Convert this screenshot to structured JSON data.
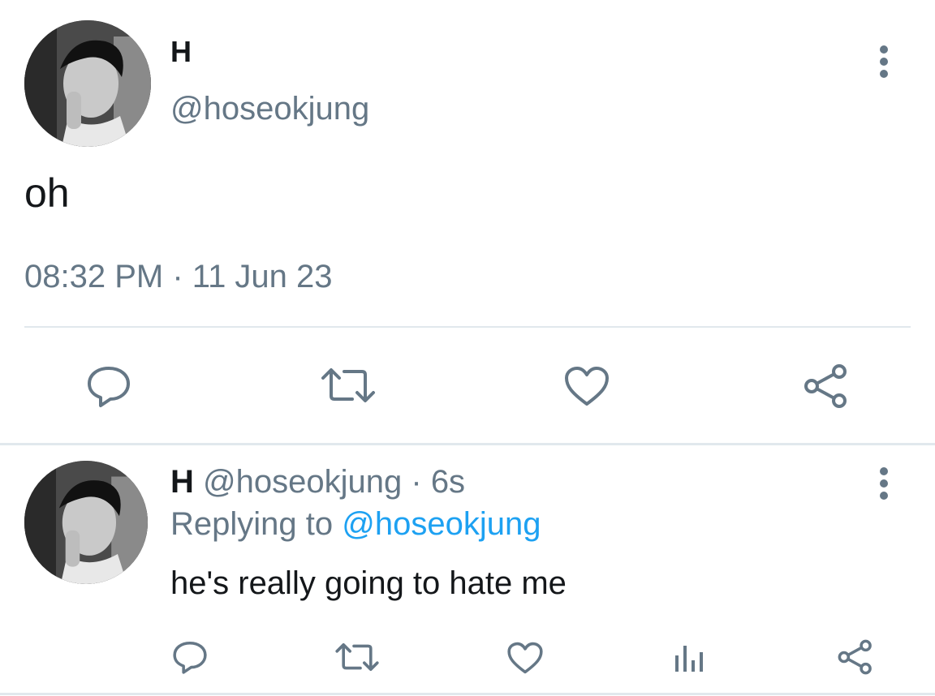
{
  "main_tweet": {
    "display_name": "H",
    "handle": "@hoseokjung",
    "text": "oh",
    "time": "08:32 PM",
    "separator": "·",
    "date": "11 Jun 23",
    "avatar": "user-avatar-bw-photo",
    "actions": [
      "reply-icon",
      "retweet-icon",
      "like-icon",
      "share-icon"
    ],
    "menu_icon": "more-vertical-icon"
  },
  "reply_tweet": {
    "display_name": "H",
    "handle": "@hoseokjung",
    "separator": "·",
    "age": "6s",
    "replying_prefix": "Replying to",
    "replying_handle": "@hoseokjung",
    "text": "he's really going to hate me",
    "avatar": "user-avatar-bw-photo",
    "actions": [
      "reply-icon",
      "retweet-icon",
      "like-icon",
      "analytics-icon",
      "share-icon"
    ],
    "menu_icon": "more-vertical-icon"
  },
  "colors": {
    "text": "#14171a",
    "muted": "#657786",
    "link": "#1da1f2",
    "divider": "#e1e8ed"
  }
}
